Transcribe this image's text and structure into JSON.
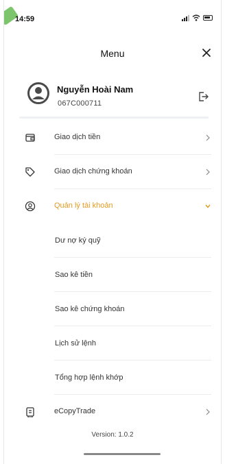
{
  "status": {
    "time": "14:59"
  },
  "header": {
    "title": "Menu"
  },
  "profile": {
    "name": "Nguyễn Hoài Nam",
    "account_id": "067C000711"
  },
  "menu": {
    "items": [
      {
        "label": "Giao dịch tiền",
        "icon": "wallet-icon"
      },
      {
        "label": "Giao dịch chứng khoán",
        "icon": "tag-icon"
      },
      {
        "label": "Quản lý tài khoản",
        "icon": "user-circle-icon",
        "expanded": true
      }
    ],
    "sub_items": [
      {
        "label": "Dư nợ ký quỹ"
      },
      {
        "label": "Sao kê tiền"
      },
      {
        "label": "Sao kê chứng khoán"
      },
      {
        "label": "Lịch sử lệnh"
      },
      {
        "label": "Tổng hợp lệnh khớp"
      }
    ],
    "bottom_item": {
      "label": "eCopyTrade",
      "icon": "document-icon"
    }
  },
  "footer": {
    "version": "Version: 1.0.2"
  },
  "colors": {
    "accent": "#e39a1f",
    "text": "#333333",
    "divider": "#ececec"
  }
}
